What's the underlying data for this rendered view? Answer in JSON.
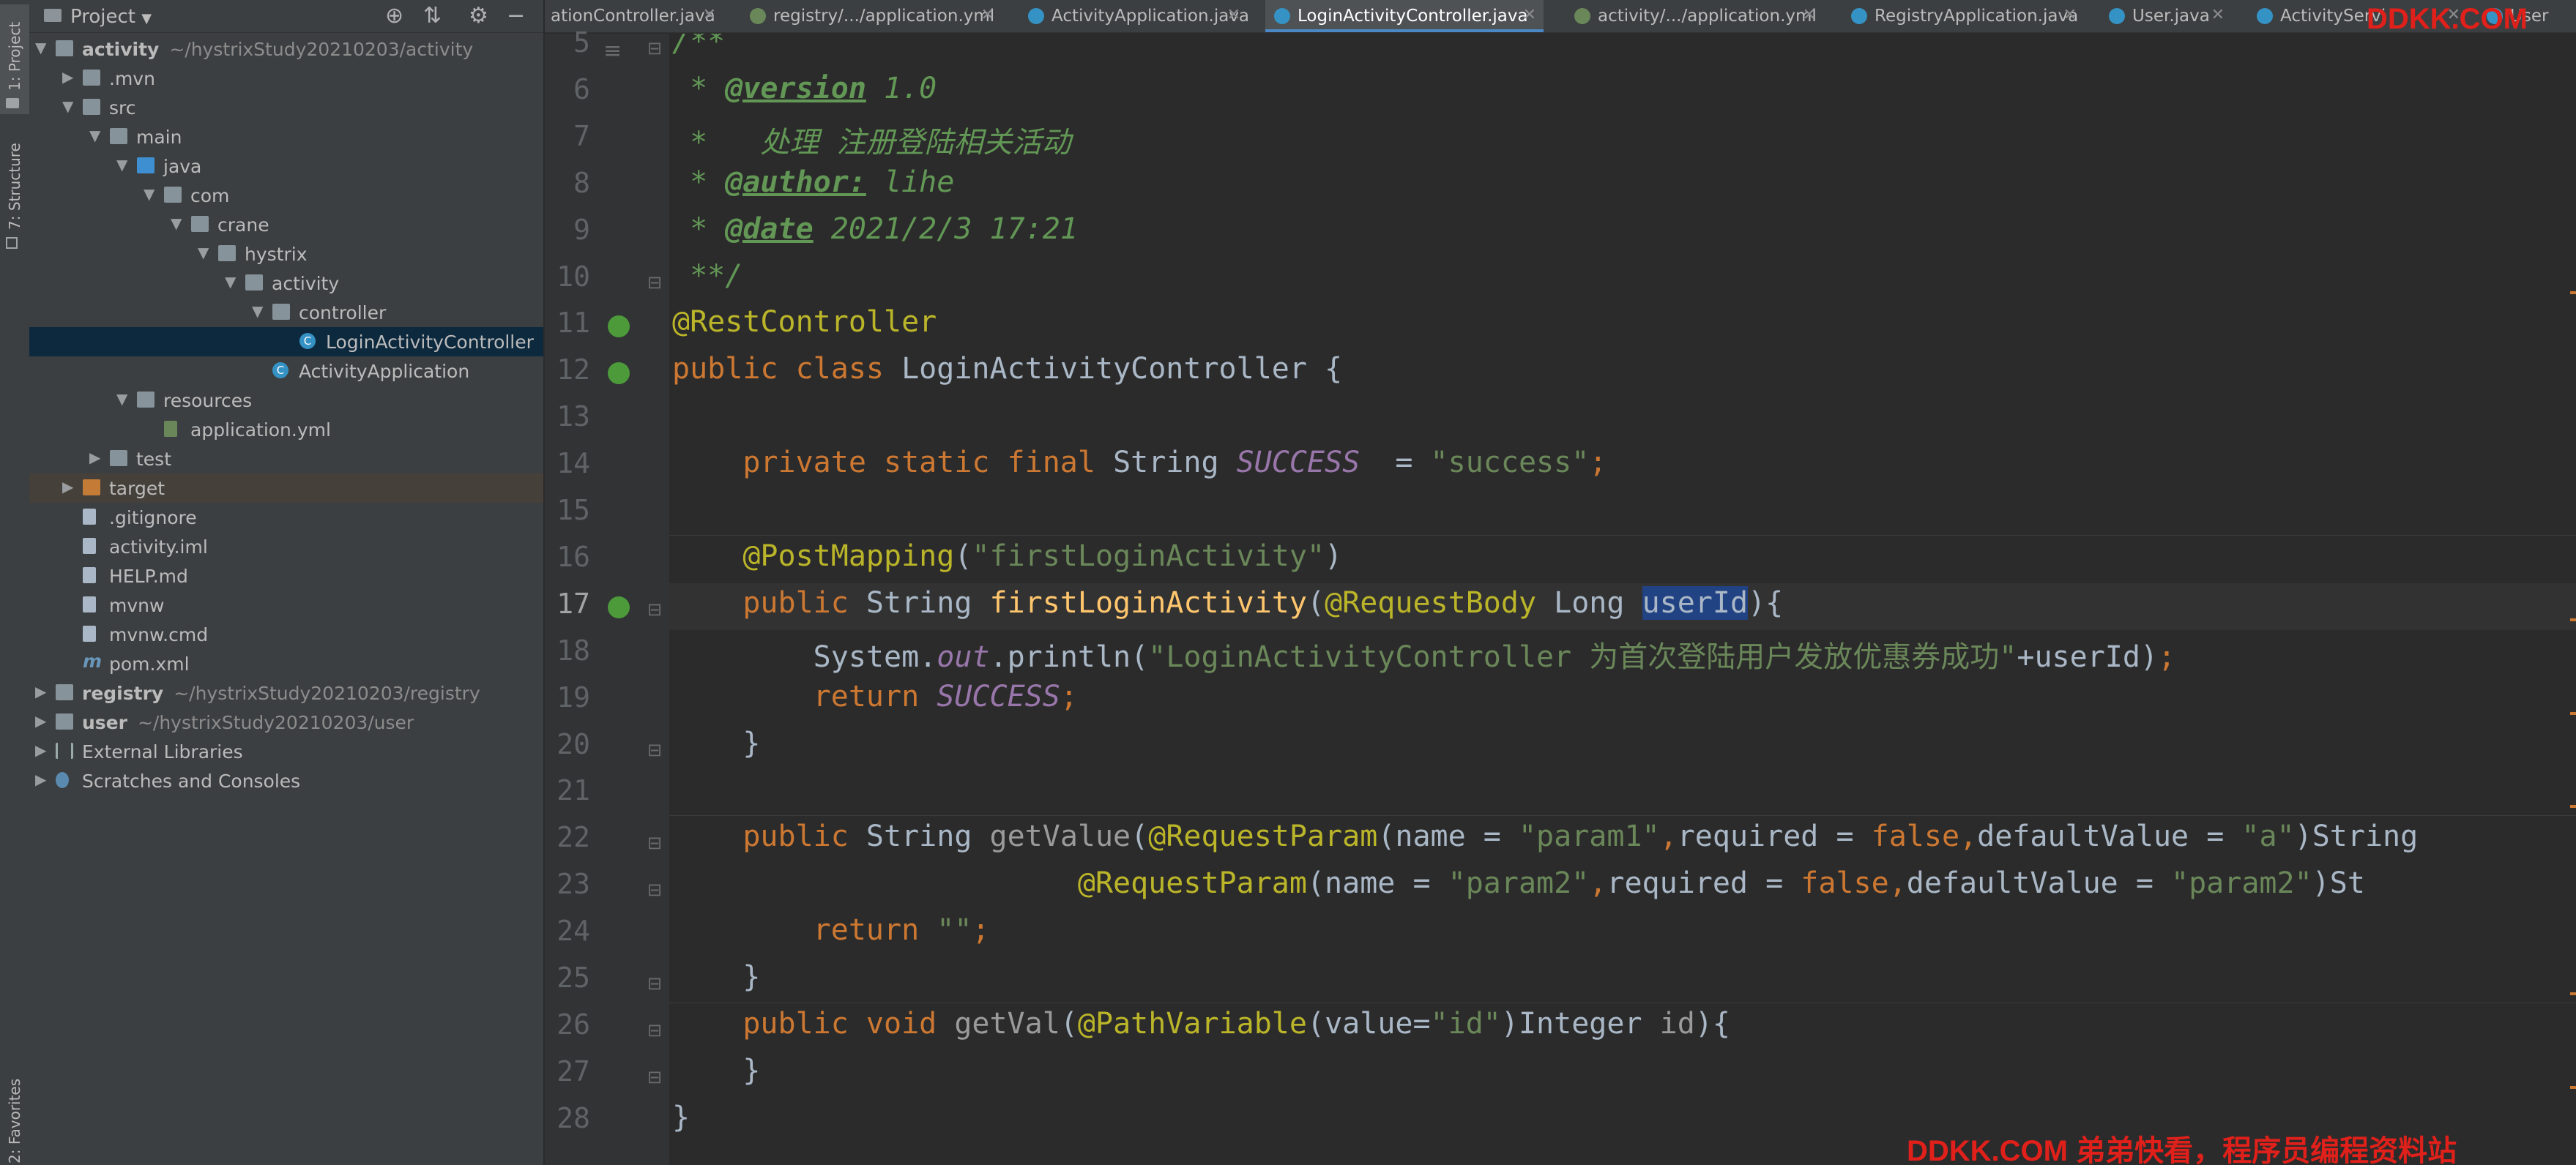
{
  "project_panel": {
    "title": "Project",
    "tree": [
      {
        "label": "activity",
        "path": "~/hystrixStudy20210203/activity",
        "bold": true,
        "indent": 0,
        "arrow": "▼",
        "icon": "folder"
      },
      {
        "label": ".mvn",
        "indent": 1,
        "arrow": "▶",
        "icon": "folder"
      },
      {
        "label": "src",
        "indent": 1,
        "arrow": "▼",
        "icon": "folder"
      },
      {
        "label": "main",
        "indent": 2,
        "arrow": "▼",
        "icon": "folder"
      },
      {
        "label": "java",
        "indent": 3,
        "arrow": "▼",
        "icon": "folder-blue"
      },
      {
        "label": "com",
        "indent": 4,
        "arrow": "▼",
        "icon": "folder"
      },
      {
        "label": "crane",
        "indent": 5,
        "arrow": "▼",
        "icon": "folder"
      },
      {
        "label": "hystrix",
        "indent": 6,
        "arrow": "▼",
        "icon": "folder"
      },
      {
        "label": "activity",
        "indent": 7,
        "arrow": "▼",
        "icon": "folder"
      },
      {
        "label": "controller",
        "indent": 8,
        "arrow": "▼",
        "icon": "folder"
      },
      {
        "label": "LoginActivityController",
        "indent": 9,
        "arrow": "",
        "icon": "class",
        "selected": true
      },
      {
        "label": "ActivityApplication",
        "indent": 8,
        "arrow": "",
        "icon": "class"
      },
      {
        "label": "resources",
        "indent": 3,
        "arrow": "▼",
        "icon": "folder"
      },
      {
        "label": "application.yml",
        "indent": 4,
        "arrow": "",
        "icon": "yml"
      },
      {
        "label": "test",
        "indent": 2,
        "arrow": "▶",
        "icon": "folder"
      },
      {
        "label": "target",
        "indent": 1,
        "arrow": "▶",
        "icon": "folder-orange",
        "highlight": true
      },
      {
        "label": ".gitignore",
        "indent": 1,
        "arrow": "",
        "icon": "file"
      },
      {
        "label": "activity.iml",
        "indent": 1,
        "arrow": "",
        "icon": "file"
      },
      {
        "label": "HELP.md",
        "indent": 1,
        "arrow": "",
        "icon": "file"
      },
      {
        "label": "mvnw",
        "indent": 1,
        "arrow": "",
        "icon": "file"
      },
      {
        "label": "mvnw.cmd",
        "indent": 1,
        "arrow": "",
        "icon": "file"
      },
      {
        "label": "pom.xml",
        "indent": 1,
        "arrow": "",
        "icon": "maven"
      },
      {
        "label": "registry",
        "path": "~/hystrixStudy20210203/registry",
        "bold": true,
        "indent": 0,
        "arrow": "▶",
        "icon": "folder"
      },
      {
        "label": "user",
        "path": "~/hystrixStudy20210203/user",
        "bold": true,
        "indent": 0,
        "arrow": "▶",
        "icon": "folder"
      },
      {
        "label": "External Libraries",
        "indent": 0,
        "arrow": "▶",
        "icon": "libs"
      },
      {
        "label": "Scratches and Consoles",
        "indent": 0,
        "arrow": "▶",
        "icon": "scratch"
      }
    ]
  },
  "side_tabs": {
    "project": "1: Project",
    "structure": "7: Structure",
    "favorites": "2: Favorites"
  },
  "tabs": [
    {
      "label": "ationController.java",
      "icon": "class"
    },
    {
      "label": "registry/.../application.yml",
      "icon": "yml"
    },
    {
      "label": "ActivityApplication.java",
      "icon": "class"
    },
    {
      "label": "LoginActivityController.java",
      "icon": "class",
      "active": true
    },
    {
      "label": "activity/.../application.yml",
      "icon": "yml"
    },
    {
      "label": "RegistryApplication.java",
      "icon": "class"
    },
    {
      "label": "User.java",
      "icon": "class"
    },
    {
      "label": "ActivityServi",
      "icon": "class"
    },
    {
      "label": "User",
      "icon": "class"
    }
  ],
  "editor": {
    "line_numbers": [
      "5",
      "6",
      "7",
      "8",
      "9",
      "10",
      "11",
      "12",
      "13",
      "14",
      "15",
      "16",
      "17",
      "18",
      "19",
      "20",
      "21",
      "22",
      "23",
      "24",
      "25",
      "26",
      "27",
      "28"
    ],
    "current_line": "17",
    "lines": [
      [
        {
          "t": "/**",
          "c": "cm"
        }
      ],
      [
        {
          "t": " * ",
          "c": "cm"
        },
        {
          "t": "@version",
          "c": "cmt"
        },
        {
          "t": " 1.0",
          "c": "cm"
        }
      ],
      [
        {
          "t": " *   处理 注册登陆相关活动",
          "c": "cm"
        }
      ],
      [
        {
          "t": " * ",
          "c": "cm"
        },
        {
          "t": "@author:",
          "c": "cmt"
        },
        {
          "t": " lihe",
          "c": "cm"
        }
      ],
      [
        {
          "t": " * ",
          "c": "cm"
        },
        {
          "t": "@date",
          "c": "cmt"
        },
        {
          "t": " 2021/2/3 17:21",
          "c": "cm"
        }
      ],
      [
        {
          "t": " **/",
          "c": "cm"
        }
      ],
      [
        {
          "t": "@RestController",
          "c": "ann"
        }
      ],
      [
        {
          "t": "public class ",
          "c": "kw"
        },
        {
          "t": "LoginActivityController {",
          "c": ""
        }
      ],
      [
        {
          "t": "",
          "c": ""
        }
      ],
      [
        {
          "t": "    private static final ",
          "c": "kw"
        },
        {
          "t": "String ",
          "c": ""
        },
        {
          "t": "SUCCESS",
          "c": "field"
        },
        {
          "t": "  = ",
          "c": ""
        },
        {
          "t": "\"success\"",
          "c": "str"
        },
        {
          "t": ";",
          "c": "kw"
        }
      ],
      [
        {
          "t": "",
          "c": ""
        }
      ],
      [
        {
          "t": "    @PostMapping",
          "c": "ann"
        },
        {
          "t": "(",
          "c": ""
        },
        {
          "t": "\"firstLoginActivity\"",
          "c": "str"
        },
        {
          "t": ")",
          "c": ""
        }
      ],
      [
        {
          "t": "    public ",
          "c": "kw"
        },
        {
          "t": "String ",
          "c": ""
        },
        {
          "t": "firstLoginActivity",
          "c": "fn"
        },
        {
          "t": "(",
          "c": ""
        },
        {
          "t": "@RequestBody ",
          "c": "ann"
        },
        {
          "t": "Long ",
          "c": ""
        },
        {
          "t": "userId",
          "c": "sel"
        },
        {
          "t": "){",
          "c": ""
        }
      ],
      [
        {
          "t": "        System.",
          "c": ""
        },
        {
          "t": "out",
          "c": "field"
        },
        {
          "t": ".println(",
          "c": ""
        },
        {
          "t": "\"LoginActivityController 为首次登陆用户发放优惠券成功\"",
          "c": "str"
        },
        {
          "t": "+userId)",
          "c": ""
        },
        {
          "t": ";",
          "c": "kw"
        }
      ],
      [
        {
          "t": "        return ",
          "c": "kw"
        },
        {
          "t": "SUCCESS",
          "c": "field"
        },
        {
          "t": ";",
          "c": "kw"
        }
      ],
      [
        {
          "t": "    }",
          "c": ""
        }
      ],
      [
        {
          "t": "",
          "c": ""
        }
      ],
      [
        {
          "t": "    public ",
          "c": "kw"
        },
        {
          "t": "String ",
          "c": ""
        },
        {
          "t": "getValue",
          "c": "gray"
        },
        {
          "t": "(",
          "c": ""
        },
        {
          "t": "@RequestParam",
          "c": "ann"
        },
        {
          "t": "(name = ",
          "c": ""
        },
        {
          "t": "\"param1\"",
          "c": "str"
        },
        {
          "t": ",",
          "c": "kw"
        },
        {
          "t": "required = ",
          "c": ""
        },
        {
          "t": "false",
          "c": "kw"
        },
        {
          "t": ",",
          "c": "kw"
        },
        {
          "t": "defaultValue = ",
          "c": ""
        },
        {
          "t": "\"a\"",
          "c": "str"
        },
        {
          "t": ")String ",
          "c": ""
        }
      ],
      [
        {
          "t": "                       @RequestParam",
          "c": "ann"
        },
        {
          "t": "(name = ",
          "c": ""
        },
        {
          "t": "\"param2\"",
          "c": "str"
        },
        {
          "t": ",",
          "c": "kw"
        },
        {
          "t": "required = ",
          "c": ""
        },
        {
          "t": "false",
          "c": "kw"
        },
        {
          "t": ",",
          "c": "kw"
        },
        {
          "t": "defaultValue = ",
          "c": ""
        },
        {
          "t": "\"param2\"",
          "c": "str"
        },
        {
          "t": ")St",
          "c": ""
        }
      ],
      [
        {
          "t": "        return ",
          "c": "kw"
        },
        {
          "t": "\"\"",
          "c": "str"
        },
        {
          "t": ";",
          "c": "kw"
        }
      ],
      [
        {
          "t": "    }",
          "c": ""
        }
      ],
      [
        {
          "t": "    public void ",
          "c": "kw"
        },
        {
          "t": "getVal",
          "c": "gray"
        },
        {
          "t": "(",
          "c": ""
        },
        {
          "t": "@PathVariable",
          "c": "ann"
        },
        {
          "t": "(value=",
          "c": ""
        },
        {
          "t": "\"id\"",
          "c": "str"
        },
        {
          "t": ")Integer ",
          "c": ""
        },
        {
          "t": "id",
          "c": "gray"
        },
        {
          "t": "){",
          "c": ""
        }
      ],
      [
        {
          "t": "    }",
          "c": ""
        }
      ],
      [
        {
          "t": "}",
          "c": ""
        }
      ]
    ]
  },
  "watermarks": {
    "top": "DDKK.COM",
    "bottom": "DDKK.COM 弟弟快看，程序员编程资料站"
  }
}
